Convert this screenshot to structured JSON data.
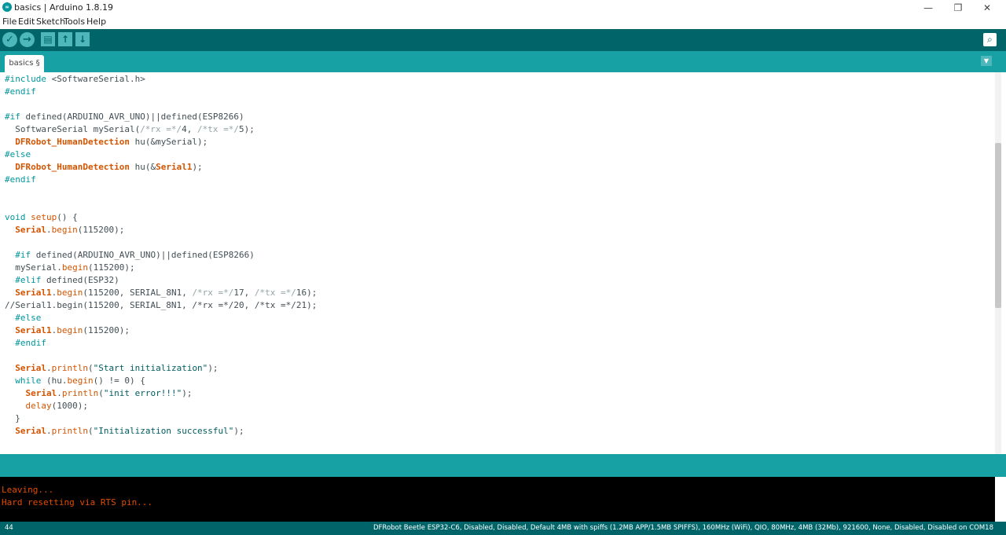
{
  "window": {
    "title": "basics | Arduino 1.8.19",
    "icon_text": "∞"
  },
  "window_controls": {
    "minimize": "—",
    "maximize": "❐",
    "close": "✕"
  },
  "menu": [
    "File",
    "Edit",
    "Sketch",
    "Tools",
    "Help"
  ],
  "toolbar": {
    "verify": "✓",
    "upload": "→",
    "new": "▤",
    "open": "↑",
    "save": "↓",
    "serial": "⌕"
  },
  "tab": {
    "label": "basics §",
    "menu_glyph": "▼"
  },
  "code_lines": [
    [
      [
        "#include ",
        "kw"
      ],
      [
        "<SoftwareSerial.h>",
        ""
      ]
    ],
    [
      [
        "#endif",
        "kw"
      ]
    ],
    [],
    [
      [
        "#if ",
        "kw"
      ],
      [
        "defined(ARDUINO_AVR_UNO)||defined(ESP8266)",
        ""
      ]
    ],
    [
      [
        "  SoftwareSerial mySerial(",
        ""
      ],
      [
        "/*rx =*/",
        "cm"
      ],
      [
        "4, ",
        ""
      ],
      [
        "/*tx =*/",
        "cm"
      ],
      [
        "5);",
        ""
      ]
    ],
    [
      [
        "  ",
        ""
      ],
      [
        "DFRobot_HumanDetection",
        "cls"
      ],
      [
        " hu(&mySerial);",
        ""
      ]
    ],
    [
      [
        "#else",
        "kw"
      ]
    ],
    [
      [
        "  ",
        ""
      ],
      [
        "DFRobot_HumanDetection",
        "cls"
      ],
      [
        " hu(&",
        ""
      ],
      [
        "Serial1",
        "cls"
      ],
      [
        ");",
        ""
      ]
    ],
    [
      [
        "#endif",
        "kw"
      ]
    ],
    [],
    [],
    [
      [
        "void ",
        "kw"
      ],
      [
        "setup",
        "fn"
      ],
      [
        "() {",
        ""
      ]
    ],
    [
      [
        "  ",
        ""
      ],
      [
        "Serial",
        "cls"
      ],
      [
        ".",
        ""
      ],
      [
        "begin",
        "fn"
      ],
      [
        "(115200);",
        ""
      ]
    ],
    [],
    [
      [
        "  #if ",
        "kw"
      ],
      [
        "defined(ARDUINO_AVR_UNO)||defined(ESP8266)",
        ""
      ]
    ],
    [
      [
        "  mySerial.",
        ""
      ],
      [
        "begin",
        "fn"
      ],
      [
        "(115200);",
        ""
      ]
    ],
    [
      [
        "  #elif ",
        "kw"
      ],
      [
        "defined(ESP32)",
        ""
      ]
    ],
    [
      [
        "  ",
        ""
      ],
      [
        "Serial1",
        "cls"
      ],
      [
        ".",
        ""
      ],
      [
        "begin",
        "fn"
      ],
      [
        "(115200, SERIAL_8N1, ",
        ""
      ],
      [
        "/*rx =*/",
        "cm"
      ],
      [
        "17, ",
        ""
      ],
      [
        "/*tx =*/",
        "cm"
      ],
      [
        "16);",
        ""
      ]
    ],
    [
      [
        "//Serial1.begin(115200, SERIAL_8N1, /*rx =*/20, /*tx =*/21);",
        ""
      ]
    ],
    [
      [
        "  #else",
        "kw"
      ]
    ],
    [
      [
        "  ",
        ""
      ],
      [
        "Serial1",
        "cls"
      ],
      [
        ".",
        ""
      ],
      [
        "begin",
        "fn"
      ],
      [
        "(115200);",
        ""
      ]
    ],
    [
      [
        "  #endif",
        "kw"
      ]
    ],
    [],
    [
      [
        "  ",
        ""
      ],
      [
        "Serial",
        "cls"
      ],
      [
        ".",
        ""
      ],
      [
        "println",
        "fn"
      ],
      [
        "(",
        ""
      ],
      [
        "\"Start initialization\"",
        "str"
      ],
      [
        ");",
        ""
      ]
    ],
    [
      [
        "  ",
        ""
      ],
      [
        "while",
        "kw"
      ],
      [
        " (hu.",
        ""
      ],
      [
        "begin",
        "fn"
      ],
      [
        "() != 0) {",
        ""
      ]
    ],
    [
      [
        "    ",
        ""
      ],
      [
        "Serial",
        "cls"
      ],
      [
        ".",
        ""
      ],
      [
        "println",
        "fn"
      ],
      [
        "(",
        ""
      ],
      [
        "\"init error!!!\"",
        "str"
      ],
      [
        ");",
        ""
      ]
    ],
    [
      [
        "    ",
        ""
      ],
      [
        "delay",
        "fn"
      ],
      [
        "(1000);",
        ""
      ]
    ],
    [
      [
        "  }",
        ""
      ]
    ],
    [
      [
        "  ",
        ""
      ],
      [
        "Serial",
        "cls"
      ],
      [
        ".",
        ""
      ],
      [
        "println",
        "fn"
      ],
      [
        "(",
        ""
      ],
      [
        "\"Initialization successful\"",
        "str"
      ],
      [
        ");",
        ""
      ]
    ]
  ],
  "console_lines": [
    "Leaving...",
    "Hard resetting via RTS pin..."
  ],
  "status": {
    "line": "44",
    "board": "DFRobot Beetle ESP32-C6, Disabled, Disabled, Default 4MB with spiffs (1.2MB APP/1.5MB SPIFFS), 160MHz (WiFi), QIO, 80MHz, 4MB (32Mb), 921600, None, Disabled, Disabled on COM18"
  }
}
